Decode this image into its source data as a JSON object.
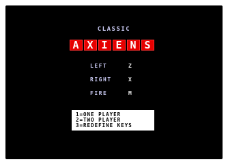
{
  "game": {
    "subtitle": "CLASSIC",
    "title_letters": [
      "A",
      "X",
      "I",
      "E",
      "N",
      "S"
    ],
    "colors": {
      "background": "#000000",
      "logo_tile": "#e60000",
      "label_text": "#c8c8f0",
      "menu_box": "#ffffff"
    }
  },
  "controls": [
    {
      "label": "LEFT",
      "key": "Z"
    },
    {
      "label": "RIGHT",
      "key": "X"
    },
    {
      "label": "FIRE",
      "key": "M"
    }
  ],
  "menu": [
    {
      "label": "1=ONE PLAYER"
    },
    {
      "label": "2=TWO PLAYER"
    },
    {
      "label": "3=REDEFINE KEYS"
    }
  ]
}
